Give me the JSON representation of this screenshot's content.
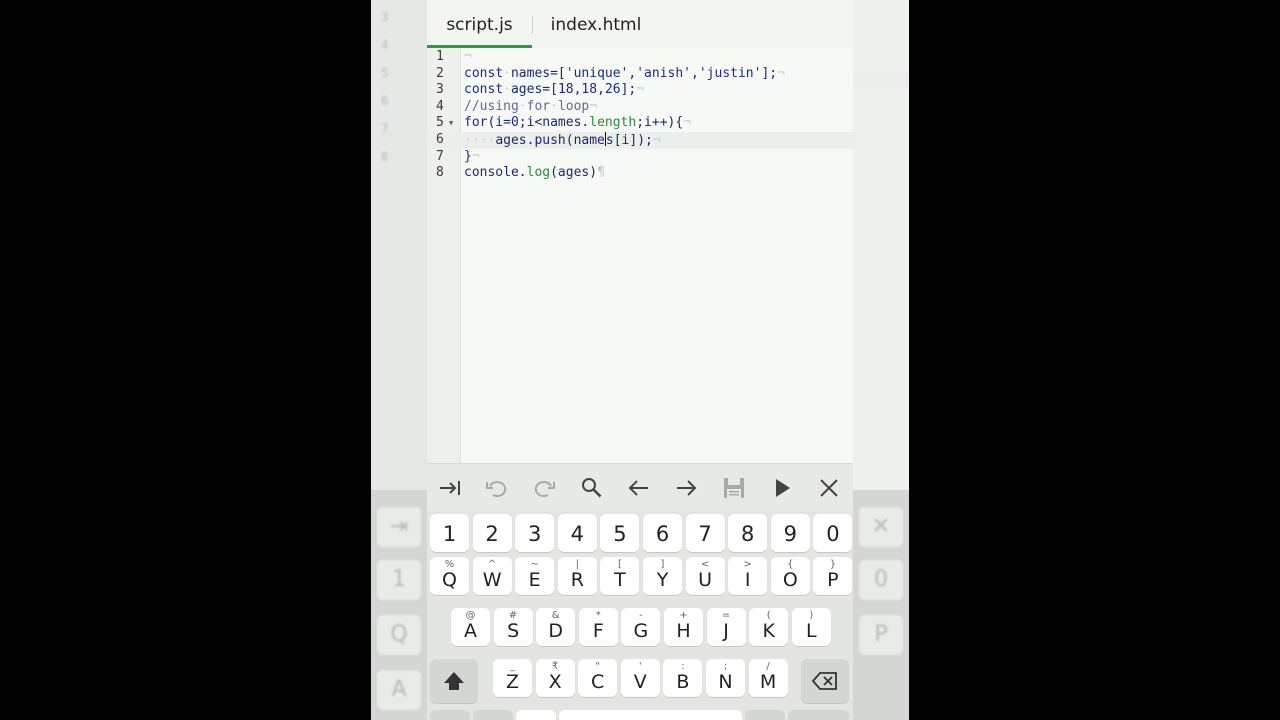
{
  "tabs": [
    {
      "label": "script.js",
      "active": true
    },
    {
      "label": "index.html",
      "active": false
    }
  ],
  "editor": {
    "active_line": 6,
    "lines": [
      {
        "n": "1"
      },
      {
        "n": "2",
        "parts": [
          [
            "kw",
            "const"
          ],
          [
            "ws",
            "·"
          ],
          [
            "plain",
            "names=["
          ],
          [
            "str",
            "'unique'"
          ],
          [
            "plain",
            ","
          ],
          [
            "str",
            "'anish'"
          ],
          [
            "plain",
            ","
          ],
          [
            "str",
            "'justin'"
          ],
          [
            "plain",
            "];"
          ],
          [
            "ws",
            "¬"
          ]
        ]
      },
      {
        "n": "3",
        "parts": [
          [
            "kw",
            "const"
          ],
          [
            "ws",
            "·"
          ],
          [
            "plain",
            "ages=["
          ],
          [
            "num",
            "18"
          ],
          [
            "plain",
            ","
          ],
          [
            "num",
            "18"
          ],
          [
            "plain",
            ","
          ],
          [
            "num",
            "26"
          ],
          [
            "plain",
            "];"
          ],
          [
            "ws",
            "¬"
          ]
        ]
      },
      {
        "n": "4",
        "parts": [
          [
            "cmt",
            "//using"
          ],
          [
            "ws",
            "·"
          ],
          [
            "cmt",
            "for"
          ],
          [
            "ws",
            "·"
          ],
          [
            "cmt",
            "loop"
          ],
          [
            "ws",
            "¬"
          ]
        ]
      },
      {
        "n": "5",
        "fold": true,
        "parts": [
          [
            "kw",
            "for"
          ],
          [
            "plain",
            "(i="
          ],
          [
            "num",
            "0"
          ],
          [
            "plain",
            ";i<names."
          ],
          [
            "fn",
            "length"
          ],
          [
            "plain",
            ";i++){"
          ],
          [
            "ws",
            "¬"
          ]
        ]
      },
      {
        "n": "6",
        "parts": [
          [
            "ws",
            "····"
          ],
          [
            "plain",
            "ages.push(name"
          ],
          [
            "cursor",
            ""
          ],
          [
            "plain",
            "s[i]);"
          ],
          [
            "ws",
            "¬"
          ]
        ]
      },
      {
        "n": "7",
        "parts": [
          [
            "plain",
            "}"
          ],
          [
            "ws",
            "¬"
          ]
        ]
      },
      {
        "n": "8",
        "parts": [
          [
            "plain",
            "console."
          ],
          [
            "fn",
            "log"
          ],
          [
            "plain",
            "(ages)"
          ],
          [
            "ws",
            "¶"
          ]
        ]
      }
    ]
  },
  "toolbar": {
    "buttons": [
      "tab-icon",
      "undo-icon",
      "redo-icon",
      "search-icon",
      "arrow-left-icon",
      "arrow-right-icon",
      "save-icon",
      "run-icon",
      "close-icon"
    ]
  },
  "keyboard": {
    "row_numbers": [
      "1",
      "2",
      "3",
      "4",
      "5",
      "6",
      "7",
      "8",
      "9",
      "0"
    ],
    "row1": [
      [
        "Q",
        "%"
      ],
      [
        "W",
        "^"
      ],
      [
        "E",
        "~"
      ],
      [
        "R",
        "|"
      ],
      [
        "T",
        "["
      ],
      [
        "Y",
        "]"
      ],
      [
        "U",
        "<"
      ],
      [
        "I",
        ">"
      ],
      [
        "O",
        "{"
      ],
      [
        "P",
        "}"
      ]
    ],
    "row2": [
      [
        "A",
        "@"
      ],
      [
        "S",
        "#"
      ],
      [
        "D",
        "&"
      ],
      [
        "F",
        "*"
      ],
      [
        "G",
        "-"
      ],
      [
        "H",
        "+"
      ],
      [
        "J",
        "="
      ],
      [
        "K",
        "("
      ],
      [
        "L",
        ")"
      ]
    ],
    "row3": [
      [
        "Z",
        "_"
      ],
      [
        "X",
        "₹"
      ],
      [
        "C",
        "\""
      ],
      [
        "V",
        "'"
      ],
      [
        "B",
        ":"
      ],
      [
        "N",
        ";"
      ],
      [
        "M",
        "/"
      ]
    ]
  },
  "colors": {
    "accent": "#2e9a3b",
    "keyword": "#1b2a80",
    "function": "#2e8b3a"
  }
}
